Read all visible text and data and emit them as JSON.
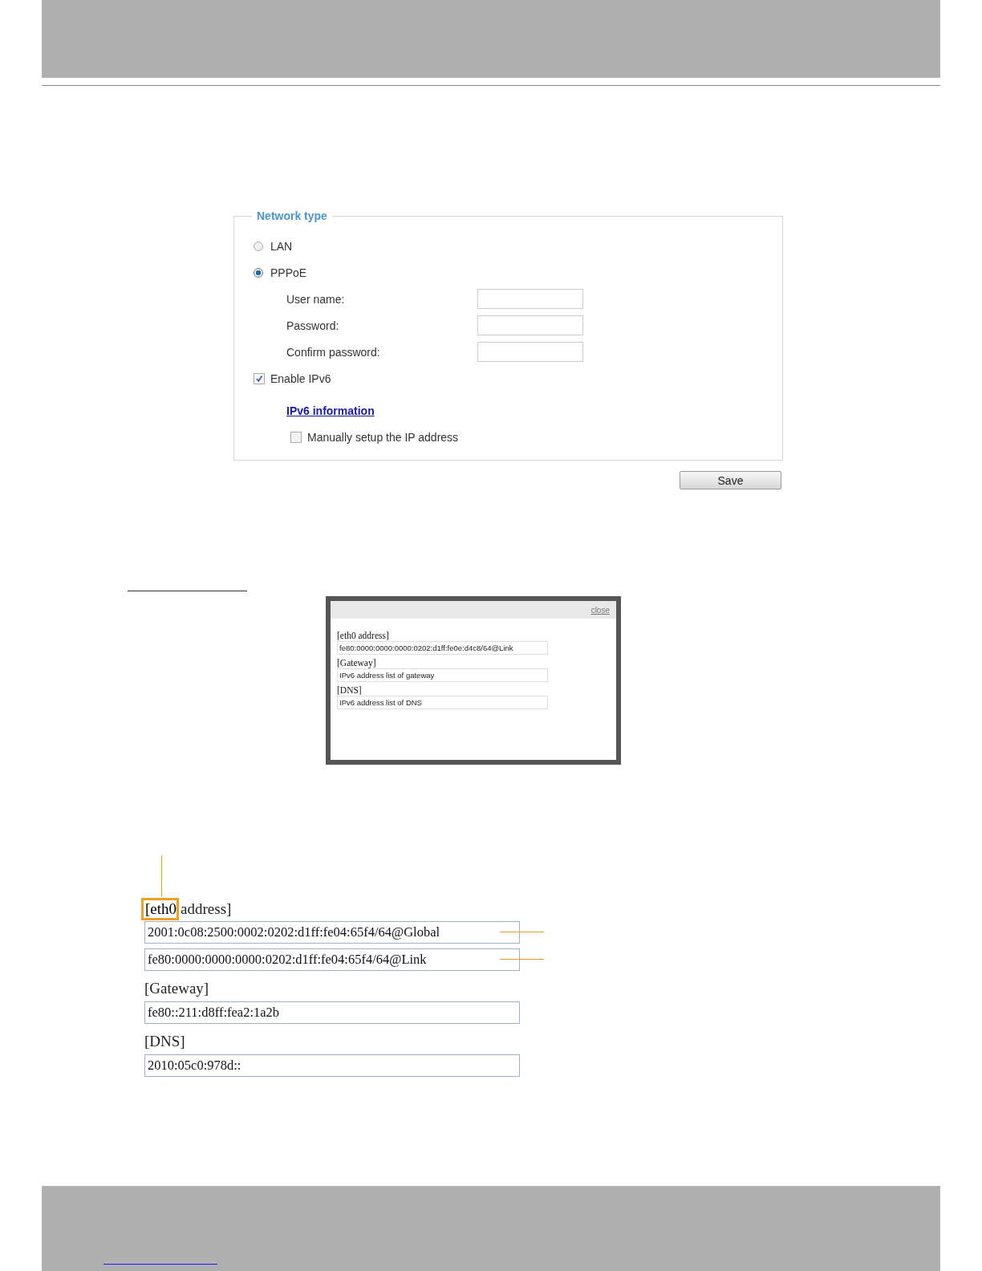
{
  "network_type": {
    "legend": "Network type",
    "options": [
      {
        "label": "LAN",
        "selected": false
      },
      {
        "label": "PPPoE",
        "selected": true
      }
    ],
    "fields": [
      {
        "label": "User name:"
      },
      {
        "label": "Password:"
      },
      {
        "label": "Confirm password:"
      }
    ],
    "enable_ipv6": {
      "label": "Enable IPv6",
      "checked": true
    },
    "ipv6_link": "IPv6 information",
    "manual_setup": {
      "label": "Manually setup the IP address",
      "checked": false
    },
    "save": "Save"
  },
  "popup": {
    "close": "close",
    "sections": [
      {
        "heading": "[eth0 address]",
        "values": [
          "fe80:0000:0000:0000:0202:d1ff:fe0e:d4c8/64@Link"
        ]
      },
      {
        "heading": "[Gateway]",
        "values": [
          "IPv6 address list of gateway"
        ]
      },
      {
        "heading": "[DNS]",
        "values": [
          "IPv6 address list of DNS"
        ]
      }
    ]
  },
  "detail": {
    "highlighted": "[eth0",
    "heading_rest": "address]",
    "sections": [
      {
        "values": [
          "2001:0c08:2500:0002:0202:d1ff:fe04:65f4/64@Global",
          "fe80:0000:0000:0000:0202:d1ff:fe04:65f4/64@Link"
        ]
      },
      {
        "heading": "[Gateway]",
        "values": [
          "fe80::211:d8ff:fea2:1a2b"
        ]
      },
      {
        "heading": "[DNS]",
        "values": [
          "2010:05c0:978d::"
        ]
      }
    ]
  }
}
